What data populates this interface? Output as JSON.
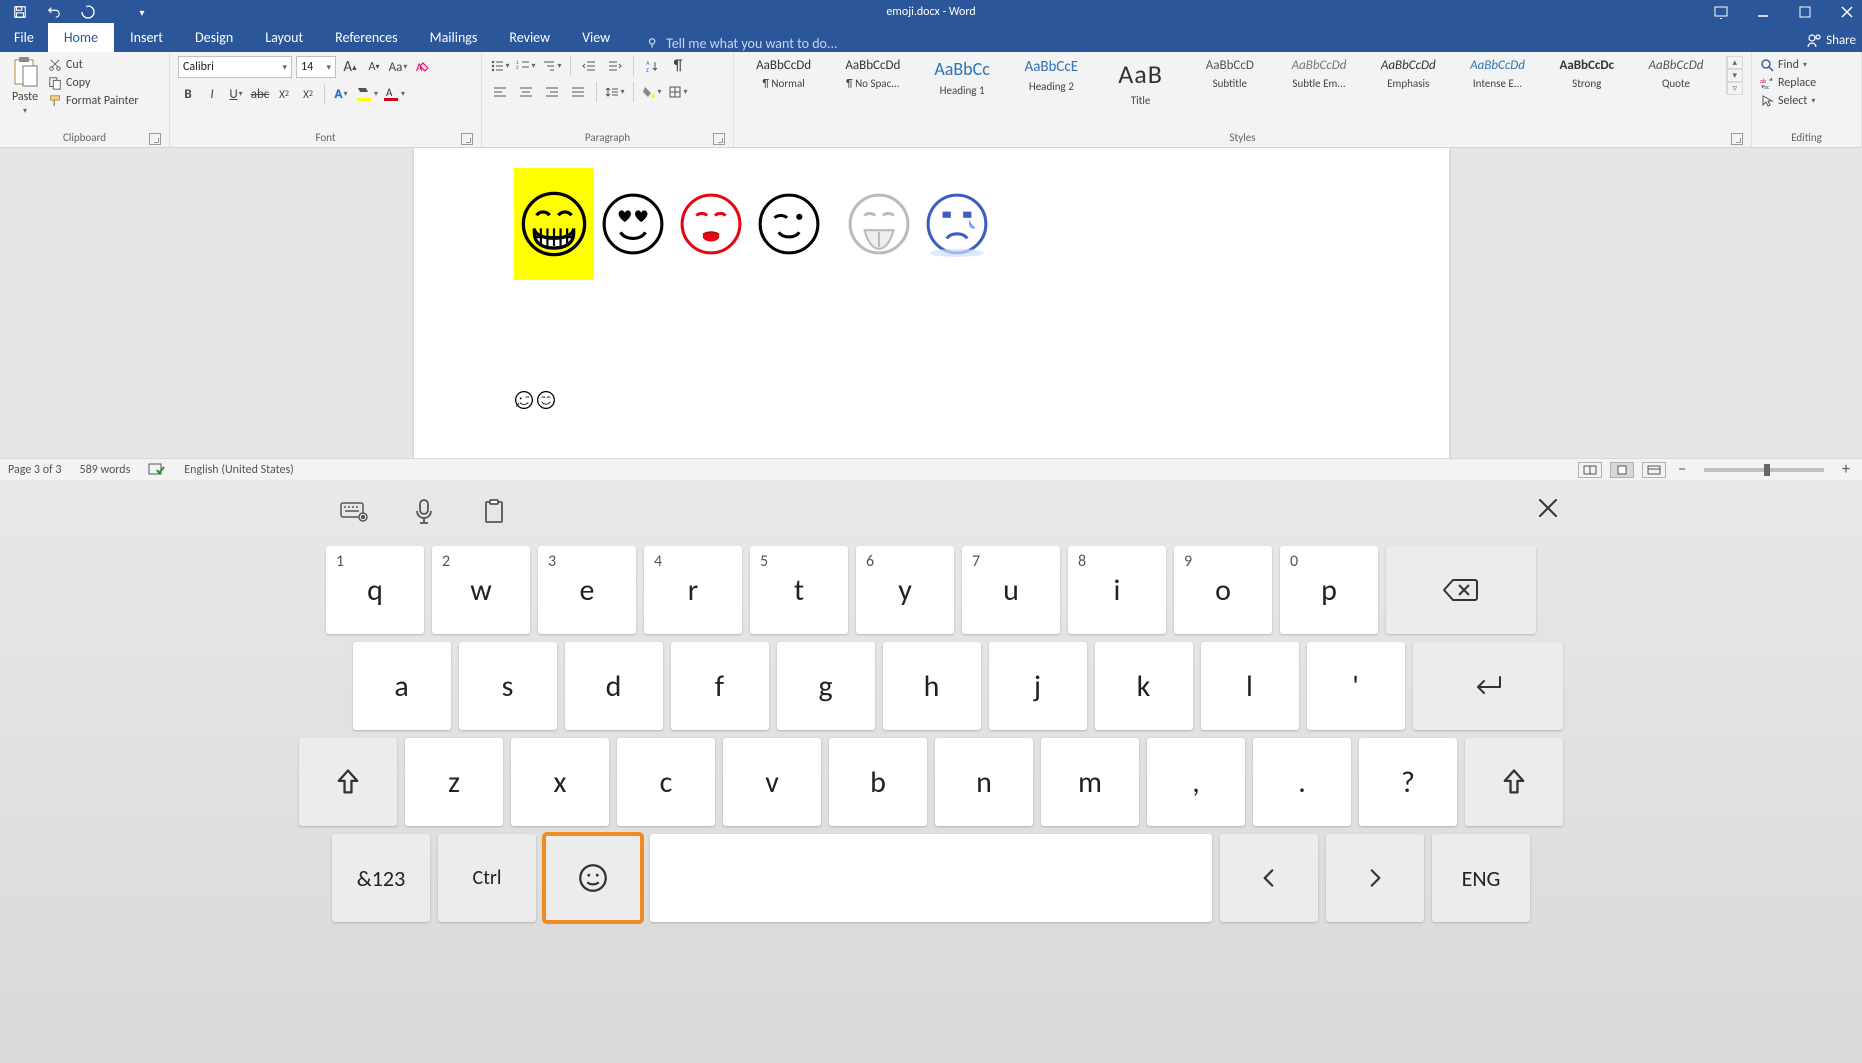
{
  "titlebar": {
    "doc_title": "emoji.docx - Word"
  },
  "menutabs": {
    "file": "File",
    "home": "Home",
    "insert": "Insert",
    "design": "Design",
    "layout": "Layout",
    "references": "References",
    "mailings": "Mailings",
    "review": "Review",
    "view": "View",
    "tellme": "Tell me what you want to do...",
    "share": "Share"
  },
  "ribbon": {
    "clipboard": {
      "label": "Clipboard",
      "paste": "Paste",
      "cut": "Cut",
      "copy": "Copy",
      "formatpainter": "Format Painter"
    },
    "font": {
      "label": "Font",
      "fontname": "Calibri",
      "fontsize": "14"
    },
    "paragraph": {
      "label": "Paragraph"
    },
    "styles": {
      "label": "Styles",
      "items": [
        {
          "name": "¶ Normal",
          "cls": "normal",
          "sample": "AaBbCcDd"
        },
        {
          "name": "¶ No Spac...",
          "cls": "tnospac",
          "sample": "AaBbCcDd"
        },
        {
          "name": "Heading 1",
          "cls": "h1",
          "sample": "AaBbCc"
        },
        {
          "name": "Heading 2",
          "cls": "h2",
          "sample": "AaBbCcE"
        },
        {
          "name": "Title",
          "cls": "title",
          "sample": "AaB"
        },
        {
          "name": "Subtitle",
          "cls": "subtitle",
          "sample": "AaBbCcD"
        },
        {
          "name": "Subtle Em...",
          "cls": "subtleem",
          "sample": "AaBbCcDd"
        },
        {
          "name": "Emphasis",
          "cls": "emph",
          "sample": "AaBbCcDd"
        },
        {
          "name": "Intense E...",
          "cls": "intense",
          "sample": "AaBbCcDd"
        },
        {
          "name": "Strong",
          "cls": "strong",
          "sample": "AaBbCcDc"
        },
        {
          "name": "Quote",
          "cls": "quote",
          "sample": "AaBbCcDd"
        }
      ]
    },
    "editing": {
      "label": "Editing",
      "find": "Find",
      "replace": "Replace",
      "select": "Select"
    }
  },
  "statusbar": {
    "page": "Page 3 of 3",
    "words": "589 words",
    "lang": "English (United States)"
  },
  "osk": {
    "row1": [
      {
        "n": "1",
        "l": "q"
      },
      {
        "n": "2",
        "l": "w"
      },
      {
        "n": "3",
        "l": "e"
      },
      {
        "n": "4",
        "l": "r"
      },
      {
        "n": "5",
        "l": "t"
      },
      {
        "n": "6",
        "l": "y"
      },
      {
        "n": "7",
        "l": "u"
      },
      {
        "n": "8",
        "l": "i"
      },
      {
        "n": "9",
        "l": "o"
      },
      {
        "n": "0",
        "l": "p"
      }
    ],
    "row2": [
      "a",
      "s",
      "d",
      "f",
      "g",
      "h",
      "j",
      "k",
      "l",
      "'"
    ],
    "row3": [
      "z",
      "x",
      "c",
      "v",
      "b",
      "n",
      "m",
      ",",
      ".",
      "?"
    ],
    "sym": "&123",
    "ctrl": "Ctrl",
    "lang": "ENG"
  }
}
